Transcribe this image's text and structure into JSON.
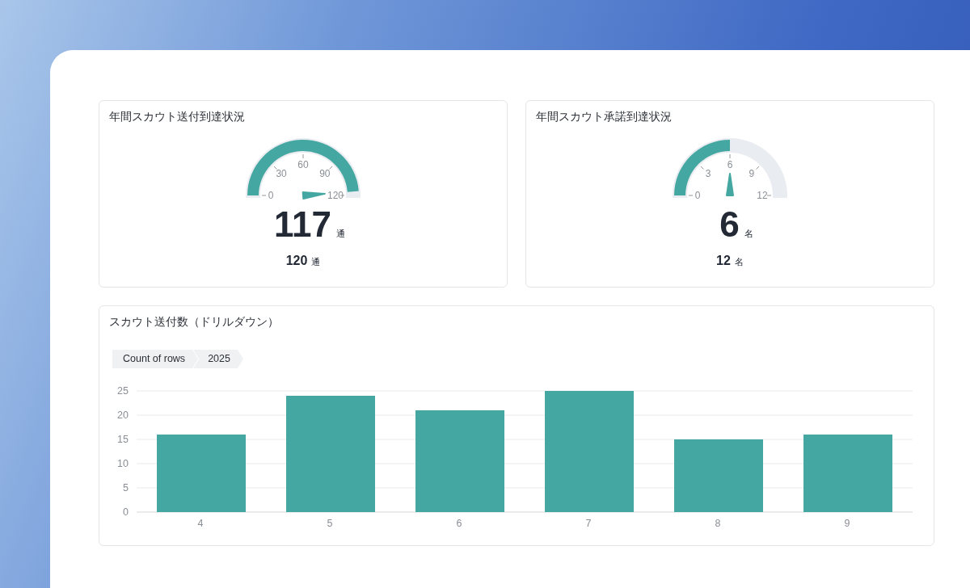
{
  "gauges": [
    {
      "title": "年間スカウト送付到達状況",
      "value": "117",
      "unit": "通",
      "target": "120",
      "target_unit": "通",
      "level": 0.975,
      "ticks": [
        "0",
        "30",
        "60",
        "90",
        "120"
      ]
    },
    {
      "title": "年間スカウト承諾到達状況",
      "value": "6",
      "unit": "名",
      "target": "12",
      "target_unit": "名",
      "level": 0.5,
      "ticks": [
        "0",
        "3",
        "6",
        "9",
        "12"
      ]
    }
  ],
  "drilldown": {
    "title": "スカウト送付数（ドリルダウン）",
    "breadcrumbs": [
      "Count of rows",
      "2025"
    ],
    "chart_data": {
      "type": "bar",
      "categories": [
        "4",
        "5",
        "6",
        "7",
        "8",
        "9"
      ],
      "series": [
        {
          "color": "#45a7a1",
          "values": [
            16,
            24,
            21,
            25,
            15,
            16
          ]
        }
      ],
      "ylim": [
        0,
        25
      ],
      "grid": true,
      "yticks": [
        0,
        5,
        10,
        15,
        20,
        25
      ]
    }
  }
}
